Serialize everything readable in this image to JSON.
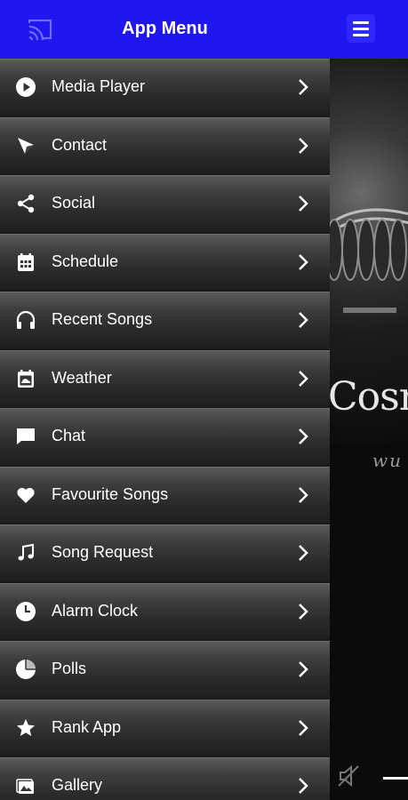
{
  "drawer": {
    "title": "App Menu",
    "items": [
      {
        "label": "Media Player",
        "icon": "play-circle-icon"
      },
      {
        "label": "Contact",
        "icon": "send-icon"
      },
      {
        "label": "Social",
        "icon": "share-icon"
      },
      {
        "label": "Schedule",
        "icon": "calendar-icon"
      },
      {
        "label": "Recent Songs",
        "icon": "headphones-icon"
      },
      {
        "label": "Weather",
        "icon": "weather-icon"
      },
      {
        "label": "Chat",
        "icon": "chat-icon"
      },
      {
        "label": "Favourite Songs",
        "icon": "heart-icon"
      },
      {
        "label": "Song Request",
        "icon": "music-note-icon"
      },
      {
        "label": "Alarm Clock",
        "icon": "clock-icon"
      },
      {
        "label": "Polls",
        "icon": "pie-chart-icon"
      },
      {
        "label": "Rank App",
        "icon": "star-icon"
      },
      {
        "label": "Gallery",
        "icon": "gallery-icon"
      }
    ]
  },
  "app": {
    "hero_title": "Cosm",
    "hero_sub": "wu"
  },
  "colors": {
    "header_blue": "#1f16f0",
    "text": "#ffffff"
  }
}
